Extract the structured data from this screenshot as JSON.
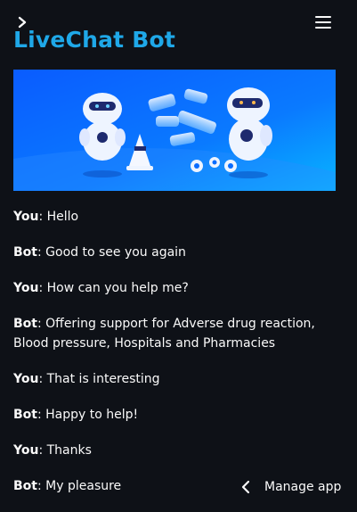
{
  "header": {
    "expand_icon": "chevron-right-icon",
    "menu_icon": "hamburger-menu-icon"
  },
  "app": {
    "title": "LiveChat Bot"
  },
  "banner": {
    "image": "chatbot-robots-illustration"
  },
  "chat": {
    "messages": [
      {
        "speaker": "You",
        "text": "Hello"
      },
      {
        "speaker": "Bot",
        "text": "Good to see you again"
      },
      {
        "speaker": "You",
        "text": "How can you help me?"
      },
      {
        "speaker": "Bot",
        "text": "Offering support for Adverse drug reaction, Blood pressure, Hospitals and Pharmacies"
      },
      {
        "speaker": "You",
        "text": "That is interesting"
      },
      {
        "speaker": "Bot",
        "text": "Happy to help!"
      },
      {
        "speaker": "You",
        "text": "Thanks"
      },
      {
        "speaker": "Bot",
        "text": "My pleasure"
      }
    ]
  },
  "footer": {
    "manage_label": "Manage app",
    "icon": "chevron-left-icon"
  },
  "colors": {
    "background": "#0e1117",
    "title": "#1fa8e8",
    "banner": "#0a6cff"
  }
}
